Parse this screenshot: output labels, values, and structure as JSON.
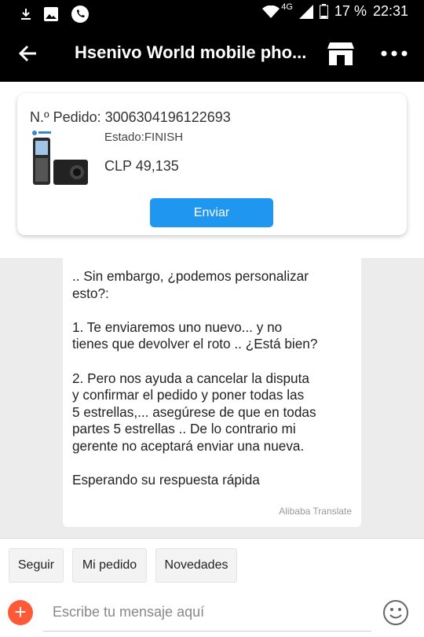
{
  "status_bar": {
    "network": "4G",
    "battery": "17 %",
    "time": "22:31"
  },
  "header": {
    "title": "Hsenivo World mobile pho..."
  },
  "order": {
    "number_label": "N.º Pedido: 3006304196122693",
    "status": "Estado:FINISH",
    "price": "CLP 49,135",
    "send_label": "Enviar"
  },
  "message": {
    "text": ".. Sin embargo, ¿podemos personalizar\nesto?:\n\n1. Te enviaremos uno nuevo... y no\ntienes que devolver el roto .. ¿Está bien?\n\n2. Pero nos ayuda a cancelar la disputa\ny confirmar el pedido y poner todas las\n5 estrellas,... asegúrese de que en todas\npartes 5 estrellas .. De lo contrario mi\ngerente no aceptará enviar una nueva.\n\nEsperando su respuesta rápida",
    "translated_by": "Alibaba Translate"
  },
  "quick_actions": [
    "Seguir",
    "Mi pedido",
    "Novedades"
  ],
  "composer": {
    "placeholder": "Escribe tu mensaje aquí"
  },
  "colors": {
    "header_bg": "#000000",
    "send_button": "#1f96f0",
    "add_button": "#ff5a37"
  }
}
